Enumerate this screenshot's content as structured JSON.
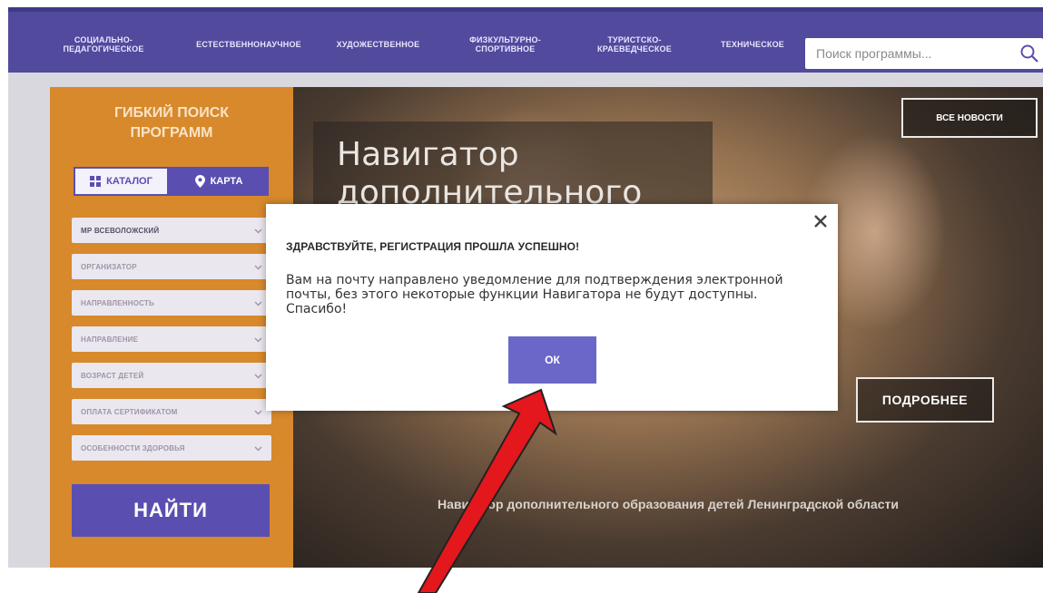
{
  "nav": {
    "items": [
      {
        "line1": "СОЦИАЛЬНО-",
        "line2": "ПЕДАГОГИЧЕСКОЕ"
      },
      {
        "line1": "ЕСТЕСТВЕННОНАУЧНОЕ",
        "line2": ""
      },
      {
        "line1": "ХУДОЖЕСТВЕННОЕ",
        "line2": ""
      },
      {
        "line1": "ФИЗКУЛЬТУРНО-",
        "line2": "СПОРТИВНОЕ"
      },
      {
        "line1": "ТУРИСТСКО-",
        "line2": "КРАЕВЕДЧЕСКОЕ"
      },
      {
        "line1": "ТЕХНИЧЕСКОЕ",
        "line2": ""
      }
    ],
    "search_placeholder": "Поиск программы..."
  },
  "sidebar": {
    "title_line1": "ГИБКИЙ ПОИСК",
    "title_line2": "ПРОГРАММ",
    "tab_catalog": "КАТАЛОГ",
    "tab_map": "КАРТА",
    "filters": [
      "МР ВСЕВОЛОЖСКИЙ",
      "ОРГАНИЗАТОР",
      "НАПРАВЛЕННОСТЬ",
      "НАПРАВЛЕНИЕ",
      "ВОЗРАСТ ДЕТЕЙ",
      "ОПЛАТА СЕРТИФИКАТОМ",
      "ОСОБЕННОСТИ ЗДОРОВЬЯ"
    ],
    "find_label": "НАЙТИ"
  },
  "hero": {
    "title_line1": "Навигатор",
    "title_line2": "дополнительного",
    "all_news": "ВСЕ НОВОСТИ",
    "more": "ПОДРОБНЕЕ",
    "footer": "Навигатор дополнительного образования детей Ленинградской области"
  },
  "modal": {
    "title": "ЗДРАВСТВУЙТЕ, РЕГИСТРАЦИЯ ПРОШЛА УСПЕШНО!",
    "text": "Вам на почту направлено уведомление для подтверждения электронной почты,  без этого некоторые функции Навигатора не будут доступны. Спасибо!",
    "ok_label": "ОК"
  },
  "colors": {
    "nav_bg": "#514a9d",
    "sidebar_bg": "#d7892c",
    "accent": "#5a4fb0",
    "ok_button": "#6a67c9",
    "arrow": "#e3171c"
  }
}
